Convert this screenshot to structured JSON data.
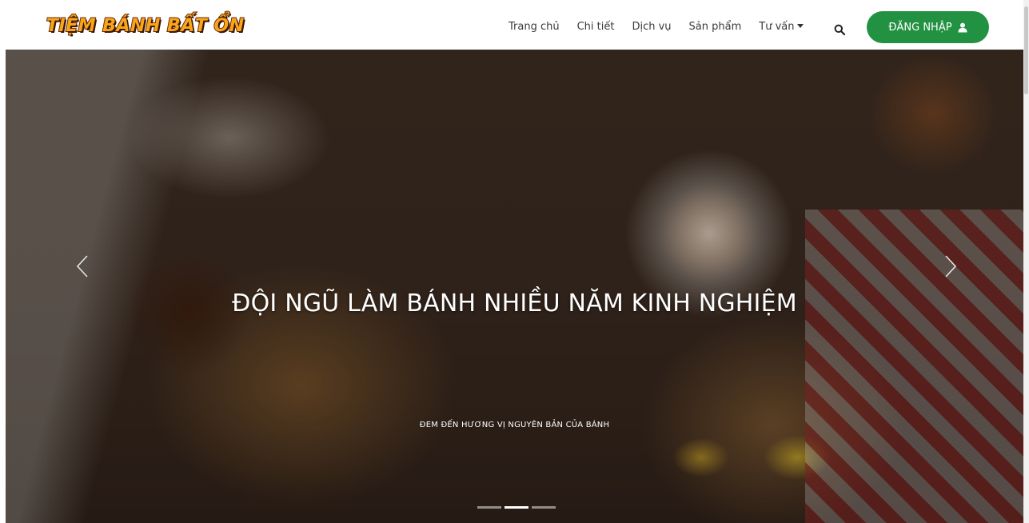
{
  "brand": {
    "logo_text": "TIỆM BÁNH BẤT ỔN"
  },
  "nav": {
    "items": [
      {
        "label": "Trang chủ"
      },
      {
        "label": "Chi tiết"
      },
      {
        "label": "Dịch vụ"
      },
      {
        "label": "Sản phẩm"
      },
      {
        "label": "Tư vấn",
        "dropdown": true
      }
    ],
    "search_icon": "search-icon",
    "login_label": "ĐĂNG NHẬP",
    "login_icon": "user-icon",
    "accent_color": "#229142"
  },
  "carousel": {
    "title": "ĐỘI NGŨ LÀM BÁNH NHIỀU NĂM KINH NGHIỆM",
    "subtitle": "ĐEM ĐẾN HƯƠNG VỊ NGUYÊN BẢN CỦA BÁNH",
    "slide_count": 3,
    "active_slide": 2
  }
}
